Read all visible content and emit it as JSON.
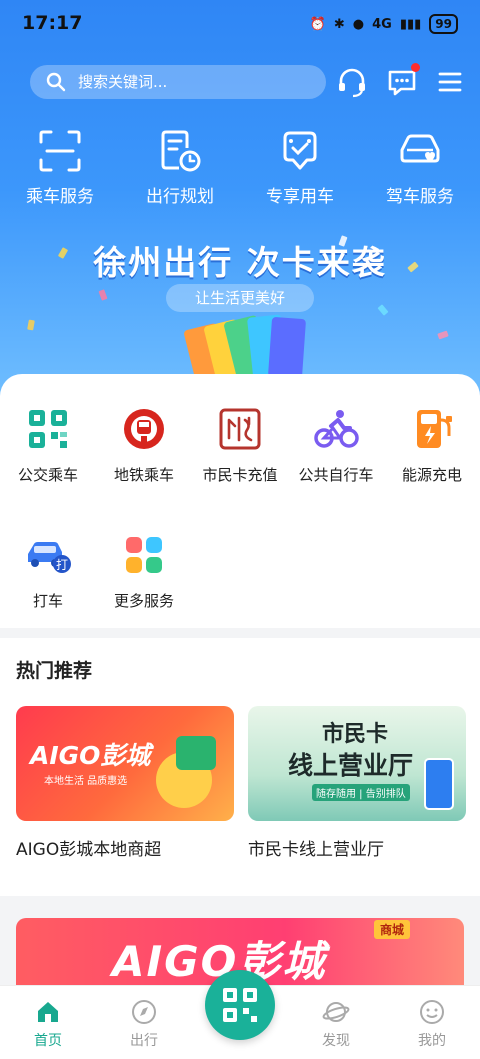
{
  "status": {
    "time": "17:17",
    "network": "4G",
    "battery": "99"
  },
  "search": {
    "placeholder": "搜索关键词..."
  },
  "quick_actions": [
    {
      "label": "乘车服务",
      "icon": "scan-icon"
    },
    {
      "label": "出行规划",
      "icon": "schedule-icon"
    },
    {
      "label": "专享用车",
      "icon": "car-check-icon"
    },
    {
      "label": "驾车服务",
      "icon": "car-heart-icon"
    }
  ],
  "banner": {
    "title": "徐州出行 次卡来袭",
    "subtitle": "让生活更美好"
  },
  "services": [
    {
      "label": "公交乘车",
      "icon": "bus-qr-icon"
    },
    {
      "label": "地铁乘车",
      "icon": "metro-icon"
    },
    {
      "label": "市民卡充值",
      "icon": "citizen-card-icon"
    },
    {
      "label": "公共自行车",
      "icon": "bicycle-icon"
    },
    {
      "label": "能源充电",
      "icon": "charging-icon"
    },
    {
      "label": "打车",
      "icon": "taxi-icon"
    },
    {
      "label": "更多服务",
      "icon": "more-services-icon"
    }
  ],
  "hot": {
    "title": "热门推荐",
    "items": [
      {
        "caption": "AIGO彭城本地商超",
        "logo": "AIGO彭城",
        "tagline": "本地生活  品质惠选"
      },
      {
        "caption": "市民卡线上营业厅",
        "logo_line1": "市民卡",
        "logo_line2": "线上营业厅",
        "tagline": "随存随用 | 告别排队"
      }
    ]
  },
  "bottom_banner": {
    "text": "AIGO彭城",
    "badge": "商城"
  },
  "tabbar": [
    {
      "label": "首页",
      "active": true
    },
    {
      "label": "出行",
      "active": false
    },
    {
      "label": "发现",
      "active": false
    },
    {
      "label": "我的",
      "active": false
    }
  ],
  "colors": {
    "brand_blue": "#2f86f5",
    "accent_green": "#18a88f",
    "promo_red": "#ff3f5c"
  }
}
